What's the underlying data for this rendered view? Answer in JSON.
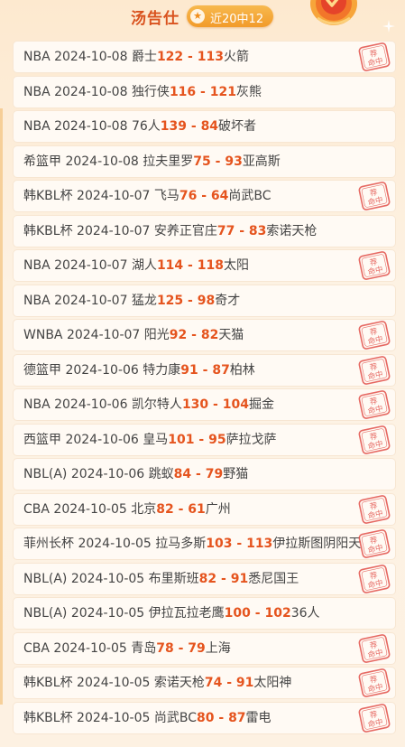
{
  "header": {
    "name": "汤告仕",
    "badge_icon": "star-icon",
    "badge_text": "近20中12"
  },
  "colors": {
    "accent": "#e5541e",
    "badge": "#f29b2a",
    "stamp": "#e0463f",
    "row_bg": "#fffaf4"
  },
  "stamp": {
    "line1": "荐",
    "line2": "命中"
  },
  "predictions": [
    {
      "league": "NBA",
      "date": "2024-10-08",
      "home": "爵士",
      "home_score": "122",
      "sep": " - ",
      "away_score": "113",
      "away": "火箭",
      "hit": true
    },
    {
      "league": "NBA",
      "date": "2024-10-08",
      "home": "独行侠",
      "home_score": "116",
      "sep": " - ",
      "away_score": "121",
      "away": "灰熊",
      "hit": false
    },
    {
      "league": "NBA",
      "date": "2024-10-08",
      "home": "76人",
      "home_score": "139",
      "sep": " - ",
      "away_score": "84",
      "away": "破坏者",
      "hit": false
    },
    {
      "league": "希篮甲",
      "date": "2024-10-08",
      "home": "拉夫里罗",
      "home_score": "75",
      "sep": " - ",
      "away_score": "93",
      "away": "亚高斯",
      "hit": false
    },
    {
      "league": "韩KBL杯",
      "date": "2024-10-07",
      "home": "飞马",
      "home_score": "76",
      "sep": " - ",
      "away_score": "64",
      "away": "尚武BC",
      "hit": true
    },
    {
      "league": "韩KBL杯",
      "date": "2024-10-07",
      "home": "安养正官庄",
      "home_score": "77",
      "sep": " - ",
      "away_score": "83",
      "away": "索诺天枪",
      "hit": false
    },
    {
      "league": "NBA",
      "date": "2024-10-07",
      "home": "湖人",
      "home_score": "114",
      "sep": " - ",
      "away_score": "118",
      "away": "太阳",
      "hit": true
    },
    {
      "league": "NBA",
      "date": "2024-10-07",
      "home": "猛龙",
      "home_score": "125",
      "sep": " - ",
      "away_score": "98",
      "away": "奇才",
      "hit": false
    },
    {
      "league": "WNBA",
      "date": "2024-10-07",
      "home": "阳光",
      "home_score": "92",
      "sep": " - ",
      "away_score": "82",
      "away": "天猫",
      "hit": true
    },
    {
      "league": "德篮甲",
      "date": "2024-10-06",
      "home": "特力康",
      "home_score": "91",
      "sep": " - ",
      "away_score": "87",
      "away": "柏林",
      "hit": true
    },
    {
      "league": "NBA",
      "date": "2024-10-06",
      "home": "凯尔特人",
      "home_score": "130",
      "sep": " - ",
      "away_score": "104",
      "away": "掘金",
      "hit": true
    },
    {
      "league": "西篮甲",
      "date": "2024-10-06",
      "home": "皇马",
      "home_score": "101",
      "sep": " - ",
      "away_score": "95",
      "away": "萨拉戈萨",
      "hit": true
    },
    {
      "league": "NBL(A)",
      "date": "2024-10-06",
      "home": "跳蚁",
      "home_score": "84",
      "sep": " - ",
      "away_score": "79",
      "away": "野猫",
      "hit": false
    },
    {
      "league": "CBA",
      "date": "2024-10-05",
      "home": "北京",
      "home_score": "82",
      "sep": " - ",
      "away_score": "61",
      "away": "广州",
      "hit": true
    },
    {
      "league": "菲州长杯",
      "date": "2024-10-05",
      "home": "拉马多斯",
      "home_score": "103",
      "sep": " - ",
      "away_score": "113",
      "away": "伊拉斯图阴阳天",
      "hit": true
    },
    {
      "league": "NBL(A)",
      "date": "2024-10-05",
      "home": "布里斯班",
      "home_score": "82",
      "sep": " - ",
      "away_score": "91",
      "away": "悉尼国王",
      "hit": true
    },
    {
      "league": "NBL(A)",
      "date": "2024-10-05",
      "home": "伊拉瓦拉老鹰",
      "home_score": "100",
      "sep": " - ",
      "away_score": "102",
      "away": "36人",
      "hit": false
    },
    {
      "league": "CBA",
      "date": "2024-10-05",
      "home": "青岛",
      "home_score": "78",
      "sep": " - ",
      "away_score": "79",
      "away": "上海",
      "hit": true
    },
    {
      "league": "韩KBL杯",
      "date": "2024-10-05",
      "home": "索诺天枪",
      "home_score": "74",
      "sep": " - ",
      "away_score": "91",
      "away": "太阳神",
      "hit": true
    },
    {
      "league": "韩KBL杯",
      "date": "2024-10-05",
      "home": "尚武BC",
      "home_score": "80",
      "sep": " - ",
      "away_score": "87",
      "away": "雷电",
      "hit": true
    }
  ]
}
